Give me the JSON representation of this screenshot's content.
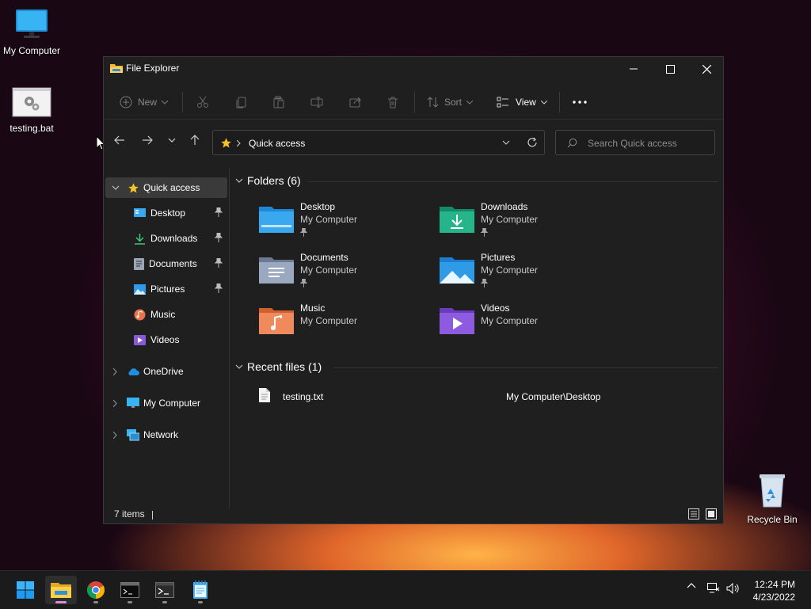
{
  "desktop": {
    "icons": [
      {
        "label": "My Computer"
      },
      {
        "label": "testing.bat"
      },
      {
        "label": "Recycle Bin"
      }
    ]
  },
  "window": {
    "title": "File Explorer",
    "toolbar": {
      "new_label": "New",
      "sort_label": "Sort",
      "view_label": "View"
    },
    "address": {
      "location": "Quick access"
    },
    "search": {
      "placeholder": "Search Quick access"
    },
    "sidebar": {
      "quick_access": "Quick access",
      "pinned": [
        {
          "label": "Desktop"
        },
        {
          "label": "Downloads"
        },
        {
          "label": "Documents"
        },
        {
          "label": "Pictures"
        },
        {
          "label": "Music"
        },
        {
          "label": "Videos"
        }
      ],
      "onedrive": "OneDrive",
      "my_computer": "My Computer",
      "network": "Network"
    },
    "folders_header": "Folders (6)",
    "folders": [
      {
        "name": "Desktop",
        "location": "My Computer"
      },
      {
        "name": "Downloads",
        "location": "My Computer"
      },
      {
        "name": "Documents",
        "location": "My Computer"
      },
      {
        "name": "Pictures",
        "location": "My Computer"
      },
      {
        "name": "Music",
        "location": "My Computer"
      },
      {
        "name": "Videos",
        "location": "My Computer"
      }
    ],
    "recent_header": "Recent files (1)",
    "recent": [
      {
        "name": "testing.txt",
        "path": "My Computer\\Desktop"
      }
    ],
    "status": {
      "items": "7 items"
    }
  },
  "taskbar": {
    "time": "12:24 PM",
    "date": "4/23/2022"
  },
  "colors": {
    "accent": "#4cc2ff",
    "window_bg": "#1f1f1f",
    "taskbar_bg": "#1b1b1b",
    "running_indicator": "#d88fd2"
  }
}
